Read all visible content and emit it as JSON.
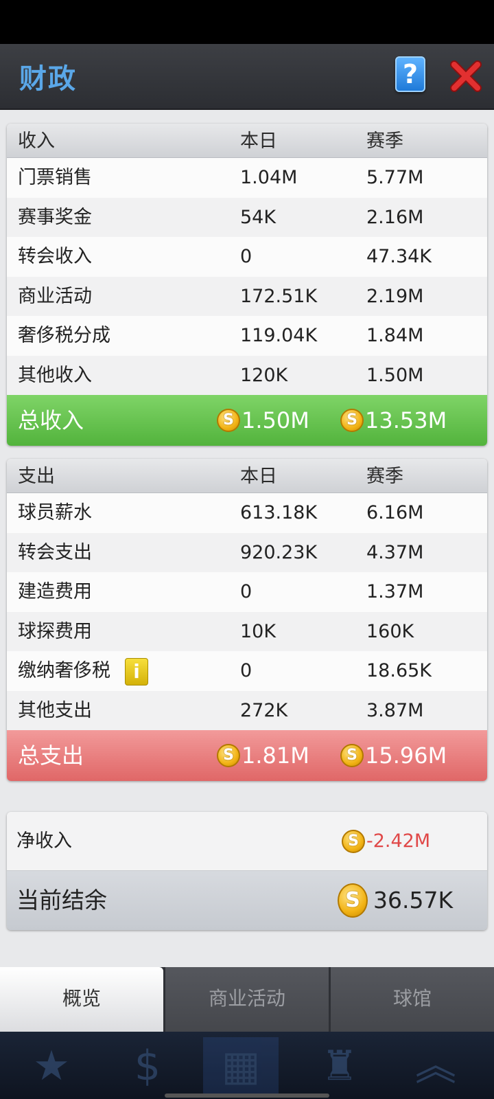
{
  "header": {
    "title": "财政",
    "help_label": "?"
  },
  "income": {
    "header": {
      "label": "收入",
      "today": "本日",
      "season": "赛季"
    },
    "rows": [
      {
        "label": "门票销售",
        "today": "1.04M",
        "season": "5.77M"
      },
      {
        "label": "赛事奖金",
        "today": "54K",
        "season": "2.16M"
      },
      {
        "label": "转会收入",
        "today": "0",
        "season": "47.34K"
      },
      {
        "label": "商业活动",
        "today": "172.51K",
        "season": "2.19M"
      },
      {
        "label": "奢侈税分成",
        "today": "119.04K",
        "season": "1.84M"
      },
      {
        "label": "其他收入",
        "today": "120K",
        "season": "1.50M"
      }
    ],
    "total": {
      "label": "总收入",
      "today": "1.50M",
      "season": "13.53M"
    }
  },
  "expense": {
    "header": {
      "label": "支出",
      "today": "本日",
      "season": "赛季"
    },
    "rows": [
      {
        "label": "球员薪水",
        "today": "613.18K",
        "season": "6.16M"
      },
      {
        "label": "转会支出",
        "today": "920.23K",
        "season": "4.37M"
      },
      {
        "label": "建造费用",
        "today": "0",
        "season": "1.37M"
      },
      {
        "label": "球探费用",
        "today": "10K",
        "season": "160K"
      },
      {
        "label": "缴纳奢侈税",
        "today": "0",
        "season": "18.65K"
      },
      {
        "label": "其他支出",
        "today": "272K",
        "season": "3.87M"
      }
    ],
    "total": {
      "label": "总支出",
      "today": "1.81M",
      "season": "15.96M"
    },
    "info_icon_label": "i"
  },
  "net": {
    "label": "净收入",
    "value": "-2.42M"
  },
  "balance": {
    "label": "当前结余",
    "value": "36.57K"
  },
  "coin_symbol": "S",
  "tabs": [
    {
      "label": "概览",
      "active": true
    },
    {
      "label": "商业活动",
      "active": false
    },
    {
      "label": "球馆",
      "active": false
    }
  ],
  "colors": {
    "title": "#5aa7e8",
    "income_total": "#5fbf47",
    "expense_total": "#e87474",
    "negative": "#e04848"
  }
}
